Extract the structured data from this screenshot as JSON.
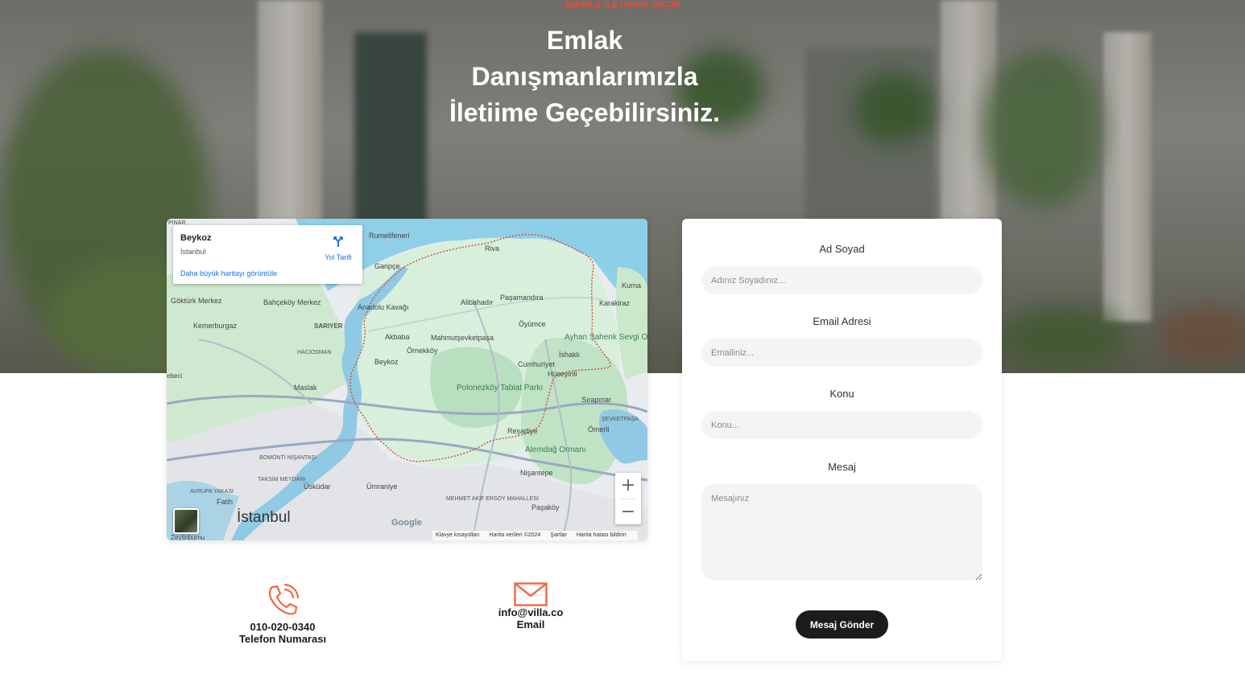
{
  "hero": {
    "eyebrow": "BIZIMLE ILETIŞIME GEÇIN",
    "headline": "Emlak Danışmanlarımızla İletiime Geçebilirsiniz."
  },
  "map": {
    "place_name": "Beykoz",
    "place_region": "İstanbul",
    "directions_label": "Yol Tarifi",
    "bigger_map_link": "Daha büyük haritayı görüntüle",
    "google_logo": "Google",
    "zoom_in": "+",
    "zoom_out": "−",
    "attribution": {
      "shortcuts": "Klavye kısayolları",
      "data": "Harita verileri ©2024",
      "terms": "Şartlar",
      "report": "Harita hatası bildirin"
    },
    "labels": [
      "Rumelifeneri",
      "Riva",
      "Garipçe",
      "Kurna",
      "Karakiraz",
      "Alibahadır",
      "Paşamandıra",
      "Göktürk Merkez",
      "Bahçeköy Merkez",
      "Anadolu Kavağı",
      "Öyümce",
      "Kemerburgaz",
      "SARIYER",
      "Akbaba",
      "Mahmutşevketpaşa",
      "Ayhan Şahenk Sevgi Ormanı",
      "HACIOSMAN",
      "Örnekköy",
      "İshaklı",
      "Beykoz",
      "Cumhuriyet",
      "Hüseyinli",
      "Maslak",
      "Polonezköy Tabiat Parkı",
      "Sırapınar",
      "ŞEVKETPAŞA",
      "Reşadiye",
      "Ömerli",
      "BOMONTİ NİŞANTAŞI",
      "Alemdağ Ormanı",
      "TAKSİM MEYDANI",
      "Nişantepe",
      "AVRUPA YAKASI",
      "Üsküdar",
      "Ümraniye",
      "MEHMET AKİF ERSOY MAHALLESİ",
      "Fatih",
      "Paşaköy",
      "İstanbul",
      "Zeytinburnu",
      "ebeci",
      "PINAR"
    ]
  },
  "contact": {
    "phone": "010-020-0340",
    "phone_label": "Telefon Numarası",
    "email": "info@villa.co",
    "email_label": "Email"
  },
  "form": {
    "name_label": "Ad Soyad",
    "name_placeholder": "Adınız Soyadınız...",
    "email_label": "Email Adresi",
    "email_placeholder": "Emailiniz...",
    "subject_label": "Konu",
    "subject_placeholder": "Konu...",
    "message_label": "Mesaj",
    "message_placeholder": "Mesajınız",
    "submit": "Mesaj Gönder"
  },
  "colors": {
    "accent": "#e94a3f",
    "icon": "#f2673e",
    "button": "#1c1c1c"
  },
  "icons": {
    "phone": "phone-icon",
    "email": "envelope-icon",
    "directions": "directions-icon"
  }
}
